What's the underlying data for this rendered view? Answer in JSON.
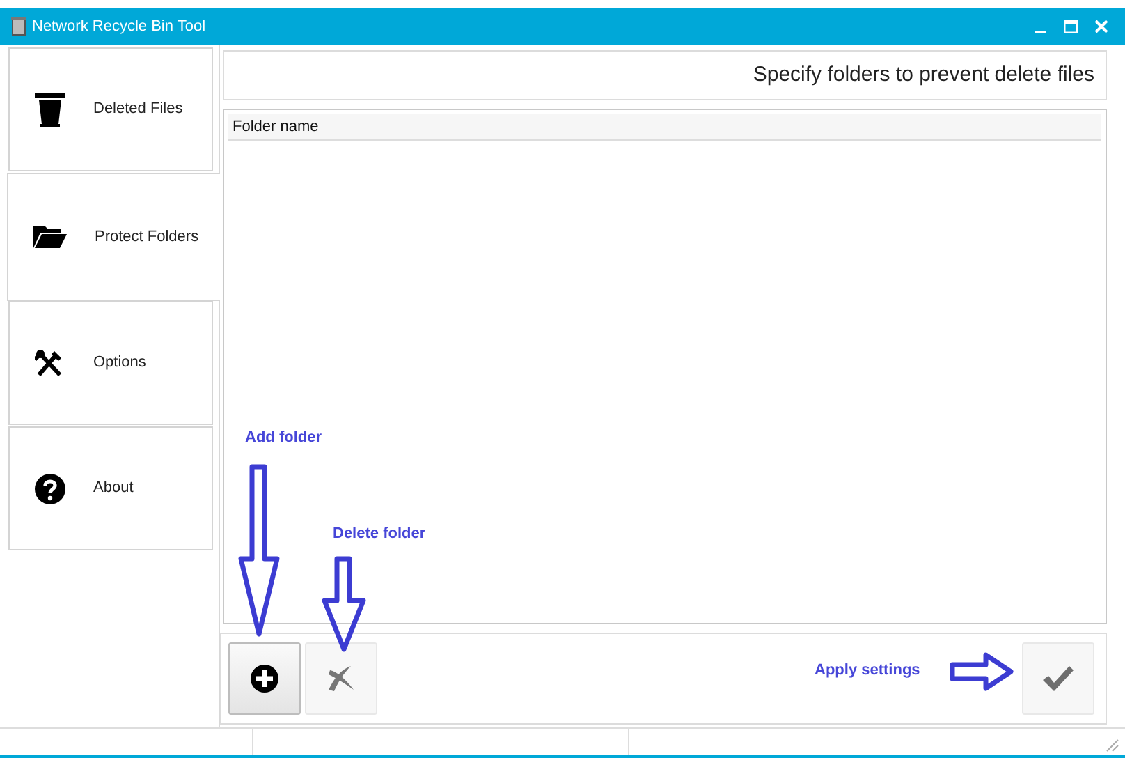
{
  "window": {
    "title": "Network Recycle Bin Tool"
  },
  "sidebar": {
    "items": [
      {
        "kind": "trash",
        "label": "Deleted Files",
        "selected": false
      },
      {
        "kind": "folder",
        "label": "Protect Folders",
        "selected": true
      },
      {
        "kind": "tools",
        "label": "Options",
        "selected": false
      },
      {
        "kind": "help",
        "label": "About",
        "selected": false
      }
    ]
  },
  "header": {
    "text": "Specify folders to prevent delete files"
  },
  "table": {
    "columns": [
      "Folder name"
    ]
  },
  "toolbar": {
    "buttons": [
      {
        "kind": "add",
        "disabled": false
      },
      {
        "kind": "delete",
        "disabled": true
      },
      {
        "kind": "apply",
        "disabled": true
      }
    ]
  },
  "annotations": [
    {
      "kind": "down",
      "text": "Add folder"
    },
    {
      "kind": "down-short",
      "text": "Delete folder"
    },
    {
      "kind": "right",
      "text": "Apply settings"
    }
  ]
}
